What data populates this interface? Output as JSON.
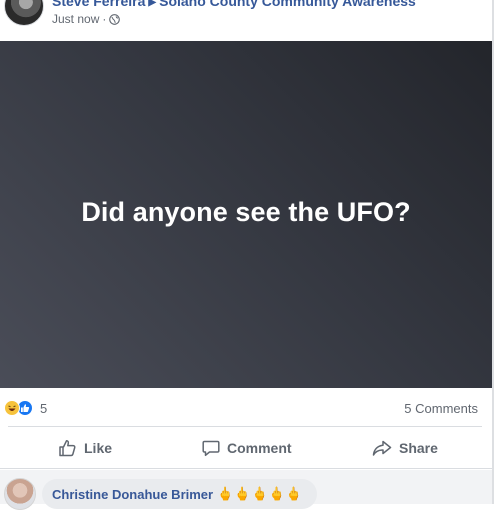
{
  "post": {
    "author": "Steve Ferreira",
    "group": "Solano County Community Awareness",
    "timestamp": "Just now",
    "separator": "·",
    "privacy_icon": "globe-icon",
    "text": "Did anyone see the UFO?"
  },
  "reactions": {
    "icons": [
      "haha-icon",
      "like-icon"
    ],
    "count": "5",
    "comments": "5 Comments"
  },
  "actions": {
    "like": "Like",
    "comment": "Comment",
    "share": "Share"
  },
  "comment": {
    "author": "Christine Donahue Brimer",
    "text": "🖕🖕🖕🖕🖕"
  },
  "colors": {
    "link": "#365899",
    "meta": "#616770",
    "like_blue": "#1877f2",
    "haha_yellow": "#f7c33c"
  }
}
